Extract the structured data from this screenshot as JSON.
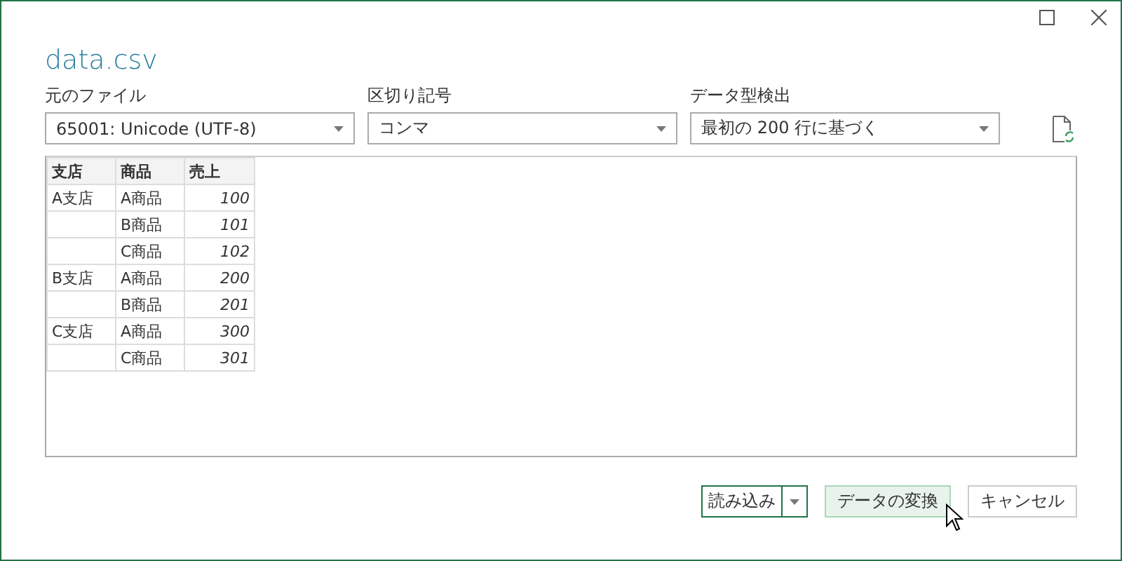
{
  "window": {
    "title": "data.csv"
  },
  "fields": [
    {
      "label": "元のファイル",
      "value": "65001: Unicode (UTF-8)"
    },
    {
      "label": "区切り記号",
      "value": "コンマ"
    },
    {
      "label": "データ型検出",
      "value": "最初の 200 行に基づく"
    }
  ],
  "table": {
    "columns": [
      "支店",
      "商品",
      "売上"
    ],
    "rows": [
      {
        "branch": "A支店",
        "product": "A商品",
        "sales": "100"
      },
      {
        "product": "B商品",
        "sales": "101"
      },
      {
        "product": "C商品",
        "sales": "102"
      },
      {
        "branch": "B支店",
        "product": "A商品",
        "sales": "200"
      },
      {
        "product": "B商品",
        "sales": "201"
      },
      {
        "branch": "C支店",
        "product": "A商品",
        "sales": "300"
      },
      {
        "product": "C商品",
        "sales": "301"
      }
    ]
  },
  "buttons": [
    {
      "label": "読み込み",
      "kind": "split",
      "default": true,
      "hovered": false
    },
    {
      "label": "データの変換",
      "kind": "plain",
      "default": false,
      "hovered": true
    },
    {
      "label": "キャンセル",
      "kind": "plain",
      "default": false,
      "hovered": false
    }
  ]
}
